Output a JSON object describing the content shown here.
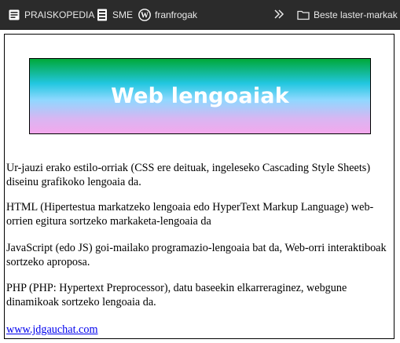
{
  "bookmarks_bar": {
    "items": [
      {
        "label": "PRAISKOPEDIA",
        "icon": "praiskopedia-icon"
      },
      {
        "label": "SME",
        "icon": "sme-icon"
      },
      {
        "label": "franfrogak",
        "icon": "wordpress-icon"
      }
    ],
    "overflow_icon": "chevron-double-right-icon",
    "folder": {
      "label": "Beste laster-markak",
      "icon": "folder-icon"
    }
  },
  "page": {
    "banner_title": "Web lengoaiak",
    "paragraphs": [
      "Ur-jauzi erako estilo-orriak (CSS ere deituak, ingeleseko Cascading Style Sheets) diseinu grafikoko lengoaia da.",
      "HTML (Hipertestua markatzeko lengoaia edo HyperText Markup Language) web-orrien egitura sortzeko markaketa-lengoaia da",
      "JavaScript (edo JS) goi-mailako programazio-lengoaia bat da, Web-orri interaktiboak sortzeko aproposa.",
      "PHP (PHP: Hypertext Preprocessor), datu baseekin elkarreraginez, webgune dinamikoak sortzeko lengoaia da."
    ],
    "link_text": "www.jdgauchat.com"
  },
  "colors": {
    "toolbar_bg": "#2b2b2b",
    "toolbar_text": "#e8e8e8",
    "link": "#0000ee",
    "banner_gradient": [
      "#00a838",
      "#22c7e0",
      "#8fd8ff",
      "#d8b6f2",
      "#f4a8ec"
    ]
  }
}
